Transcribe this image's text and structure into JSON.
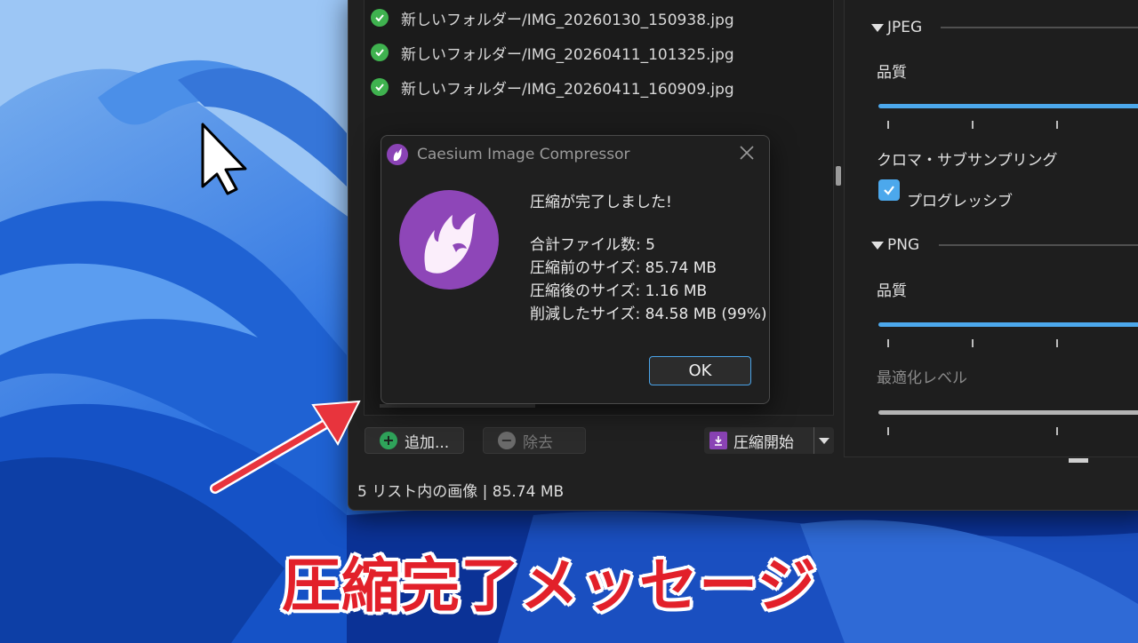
{
  "files": [
    {
      "name": "新しいフォルダー/IMG_20260130_150938.jpg",
      "status": "done"
    },
    {
      "name": "新しいフォルダー/IMG_20260411_101325.jpg",
      "status": "done"
    },
    {
      "name": "新しいフォルダー/IMG_20260411_160909.jpg",
      "status": "done"
    }
  ],
  "toolbar": {
    "add_label": "追加...",
    "remove_label": "除去",
    "compress_label": "圧縮開始"
  },
  "status_bar": "5 リスト内の画像 | 85.74 MB",
  "settings": {
    "jpeg": {
      "heading": "JPEG",
      "quality_label": "品質",
      "chroma_label": "クロマ・サブサンプリング",
      "progressive_label": "プログレッシブ",
      "progressive_checked": true
    },
    "png": {
      "heading": "PNG",
      "quality_label": "品質",
      "optimization_label": "最適化レベル"
    }
  },
  "dialog": {
    "title": "Caesium Image Compressor",
    "heading": "圧縮が完了しました!",
    "total_files": "合計ファイル数: 5",
    "size_before": "圧縮前のサイズ: 85.74 MB",
    "size_after": "圧縮後のサイズ: 1.16 MB",
    "size_saved": "削減したサイズ: 84.58 MB (99%)",
    "ok_label": "OK"
  },
  "caption": "圧縮完了メッセージ",
  "colors": {
    "accent": "#4ca8ec",
    "success": "#3fb24f",
    "brand": "#8a43b5",
    "caption": "#e2202a"
  }
}
